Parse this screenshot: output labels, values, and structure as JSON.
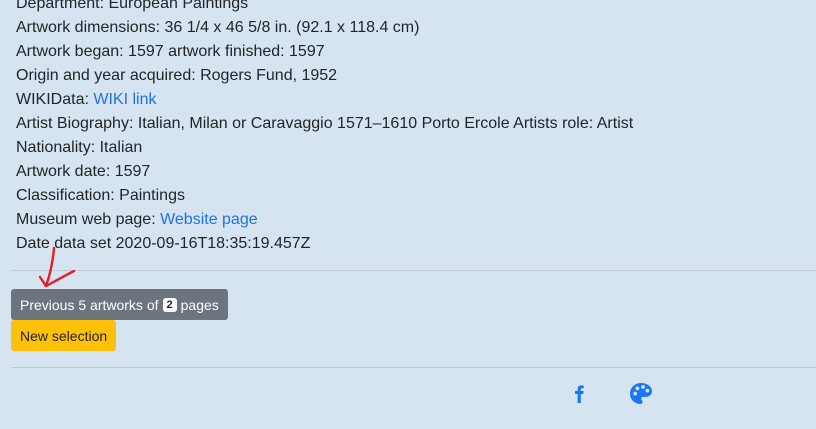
{
  "details": [
    {
      "label": "Department: European Paintings"
    },
    {
      "label": "Artwork dimensions: 36 1/4 x 46 5/8 in. (92.1 x 118.4 cm)"
    },
    {
      "label": "Artwork began: 1597 artwork finished: 1597"
    },
    {
      "label": "Origin and year acquired: Rogers Fund, 1952"
    },
    {
      "label": "WIKIData: ",
      "link": "WIKI link"
    },
    {
      "label": "Artist Biography: Italian, Milan or Caravaggio 1571–1610 Porto Ercole Artists role: Artist"
    },
    {
      "label": "Nationality: Italian"
    },
    {
      "label": "Artwork date: 1597"
    },
    {
      "label": "Classification: Paintings"
    },
    {
      "label": "Museum web page: ",
      "link": "Website page"
    },
    {
      "label": "Date data set 2020-09-16T18:35:19.457Z"
    }
  ],
  "pagination": {
    "prev_label": "Previous 5 artworks of",
    "badge": "2",
    "suffix": "pages"
  },
  "new_selection_label": "New selection",
  "footer_icons": [
    "facebook-icon",
    "palette-icon"
  ],
  "colors": {
    "background": "#d6e4f1",
    "link": "#1a73e8",
    "prev_button": "#6c757d",
    "new_button": "#ffc107",
    "icon": "#1877f2",
    "annotation_arrow": "#e0202a"
  }
}
